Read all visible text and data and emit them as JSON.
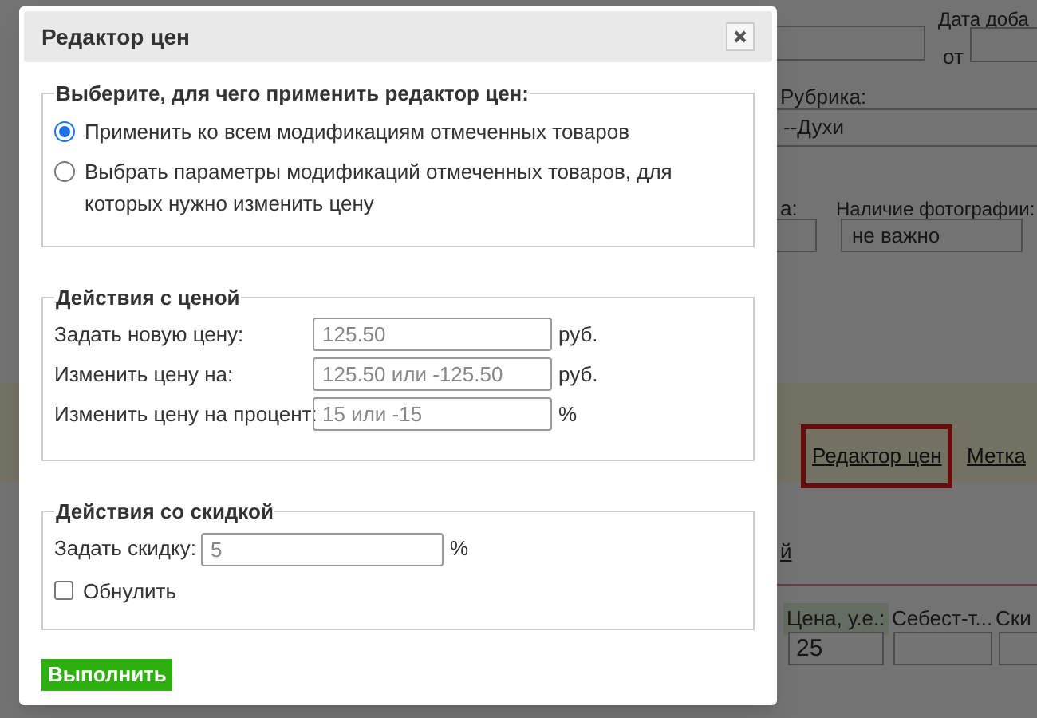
{
  "background": {
    "date_label": "Дата доба",
    "date_from": "от",
    "rubric": {
      "label": "Рубрика:",
      "value": "--Духи"
    },
    "filter_cut_label": "а:",
    "photo": {
      "label": "Наличие фотографии:",
      "value": "не важно"
    },
    "toolbar_links": [
      {
        "label": "Редактор цен",
        "highlighted": true
      },
      {
        "label": "Метка",
        "highlighted": false
      }
    ],
    "link_cut": "й",
    "rows": [
      {
        "price_label": "Цена, у.е.:",
        "cost_label": "Себест-т...",
        "discount_label": "Ски",
        "price_value": "25"
      }
    ]
  },
  "dialog": {
    "title": "Редактор цен",
    "apply_to": {
      "legend": "Выберите, для чего применить редактор цен:",
      "options": [
        {
          "label": "Применить ко всем модификациям отмеченных товаров",
          "selected": true
        },
        {
          "label": "Выбрать параметры модификаций отмеченных товаров, для которых нужно изменить цену",
          "selected": false
        }
      ]
    },
    "price_actions": {
      "legend": "Действия с ценой",
      "rows": [
        {
          "label": "Задать новую цену:",
          "placeholder": "125.50",
          "unit": "руб."
        },
        {
          "label": "Изменить цену на:",
          "placeholder": "125.50 или -125.50",
          "unit": "руб."
        },
        {
          "label": "Изменить цену на процент:",
          "placeholder": "15 или -15",
          "unit": "%"
        }
      ]
    },
    "discount_actions": {
      "legend": "Действия со скидкой",
      "rows": [
        {
          "label": "Задать скидку:",
          "placeholder": "5",
          "unit": "%"
        }
      ],
      "reset": {
        "label": "Обнулить",
        "checked": false
      }
    },
    "submit": "Выполнить"
  }
}
